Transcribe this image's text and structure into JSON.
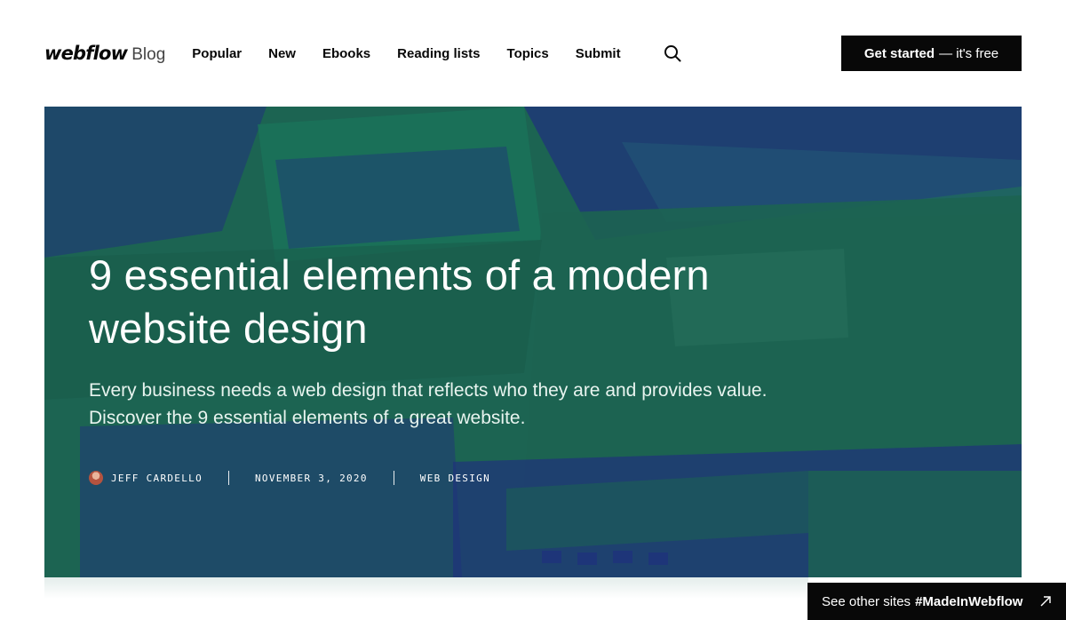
{
  "header": {
    "logo": {
      "wordmark": "webflow",
      "suffix": "Blog"
    },
    "nav": [
      {
        "label": "Popular"
      },
      {
        "label": "New"
      },
      {
        "label": "Ebooks"
      },
      {
        "label": "Reading lists"
      },
      {
        "label": "Topics"
      },
      {
        "label": "Submit"
      }
    ],
    "search_icon": "search-icon",
    "cta": {
      "strong": "Get started",
      "light": "— it's free"
    }
  },
  "hero": {
    "title": "9 essential elements of a modern website design",
    "excerpt": "Every business needs a web design that reflects who they are and provides value. Discover the 9 essential elements of a great website.",
    "meta": {
      "author": "JEFF CARDELLO",
      "date": "NOVEMBER 3, 2020",
      "category": "WEB DESIGN"
    },
    "colors": {
      "base": "#1e6a5a",
      "overlay": "#23318a"
    }
  },
  "badge": {
    "text": "See other sites",
    "hashtag": "#MadeInWebflow",
    "icon": "arrow-up-right-icon"
  }
}
